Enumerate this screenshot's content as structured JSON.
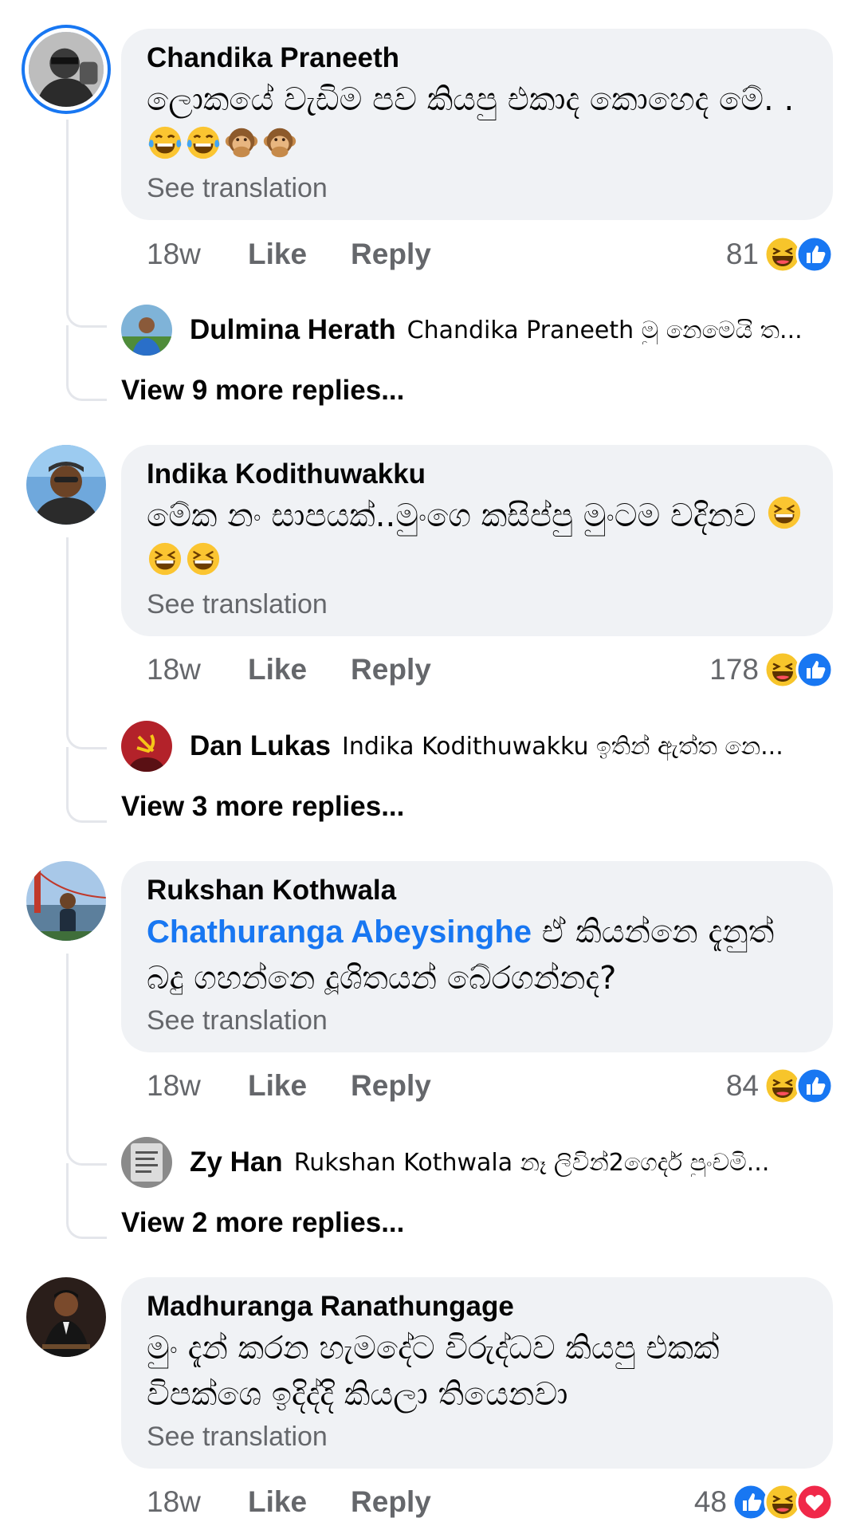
{
  "comments": [
    {
      "author": "Chandika Praneeth",
      "text": "ලොකයේ වැඩිම පව කියපු එකාද කොහෙද මේ. .",
      "emoji": [
        "tears-of-joy",
        "tears-of-joy",
        "speak-no-evil-monkey",
        "speak-no-evil-monkey"
      ],
      "see_translation": "See translation",
      "time": "18w",
      "like": "Like",
      "reply": "Reply",
      "reaction_count": "81",
      "reactions": [
        "haha",
        "like"
      ],
      "reply_preview": {
        "author": "Dulmina Herath",
        "text": "Chandika Praneeth මු නෙමෙයි ත..."
      },
      "view_more": "View 9 more replies..."
    },
    {
      "author": "Indika Kodithuwakku",
      "text": "මේක නං සාපයක්..මුංගෙ කසිප්පු මුංටම වදිනව",
      "emoji": [
        "grinning-squinting",
        "grinning-squinting",
        "grinning-squinting"
      ],
      "see_translation": "See translation",
      "time": "18w",
      "like": "Like",
      "reply": "Reply",
      "reaction_count": "178",
      "reactions": [
        "haha",
        "like"
      ],
      "reply_preview": {
        "author": "Dan Lukas",
        "text": "Indika Kodithuwakku ඉතින් ඇත්ත නෙ..."
      },
      "view_more": "View 3 more replies..."
    },
    {
      "author": "Rukshan Kothwala",
      "mention": "Chathuranga Abeysinghe",
      "text": "ඒ කියන්නෙ දැනුත් බදු ගහන්නෙ දූශිතයන් බේරගන්නද?",
      "see_translation": "See translation",
      "time": "18w",
      "like": "Like",
      "reply": "Reply",
      "reaction_count": "84",
      "reactions": [
        "haha",
        "like"
      ],
      "reply_preview": {
        "author": "Zy Han",
        "text": "Rukshan Kothwala නෑ ලිවින්2ගෙදර් පුංචමි..."
      },
      "view_more": "View 2 more replies..."
    },
    {
      "author": "Madhuranga Ranathungage",
      "text": "මුං දැන් කරන හැමදේට විරුද්ධව කියපු එකක් විපක්ශෙ ඉදිද්දි කියලා තියෙනවා",
      "see_translation": "See translation",
      "time": "18w",
      "like": "Like",
      "reply": "Reply",
      "reaction_count": "48",
      "reactions": [
        "like",
        "haha",
        "love"
      ]
    }
  ],
  "colors": {
    "bubble": "#f0f2f5",
    "secondary_text": "#65676b",
    "accent": "#1877f2",
    "thread_line": "#e4e6eb"
  }
}
